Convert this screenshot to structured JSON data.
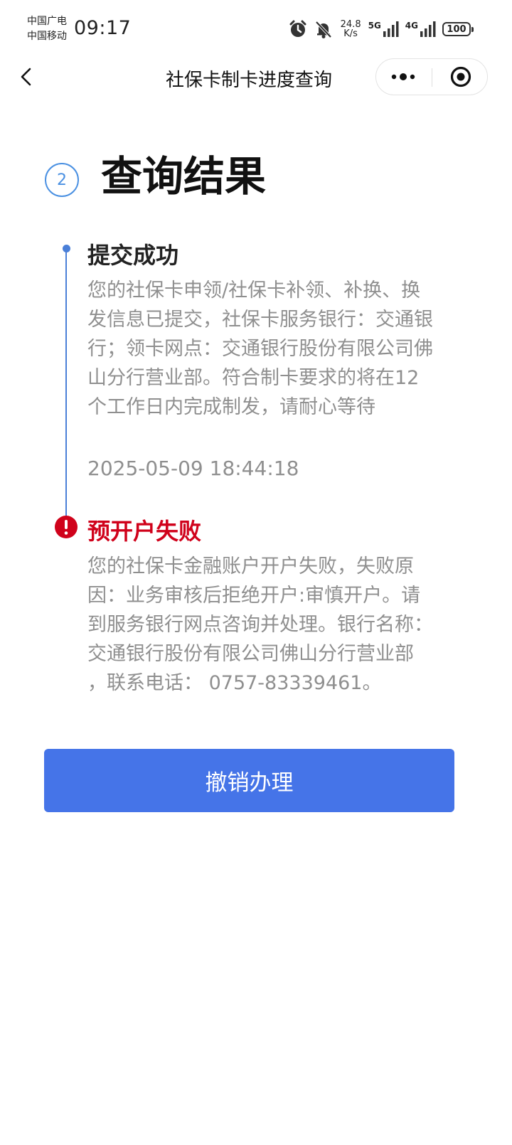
{
  "status_bar": {
    "carrier_1": "中国广电",
    "carrier_2": "中国移动",
    "time": "09:17",
    "net_speed_value": "24.8",
    "net_speed_unit": "K/s",
    "sig_5g": "5G",
    "sig_4g": "4G",
    "battery": "100"
  },
  "nav": {
    "title": "社保卡制卡进度查询"
  },
  "step": {
    "number": "2",
    "title": "查询结果"
  },
  "timeline": [
    {
      "status": "success",
      "title": "提交成功",
      "body": "您的社保卡申领/社保卡补领、补换、换发信息已提交，社保卡服务银行：交通银行；领卡网点：交通银行股份有限公司佛山分行营业部。符合制卡要求的将在12个工作日内完成制发，请耐心等待",
      "time": "2025-05-09 18:44:18"
    },
    {
      "status": "error",
      "title": "预开户失败",
      "body": "您的社保卡金融账户开户失败，失败原因：业务审核后拒绝开户:审慎开户。请到服务银行网点咨询并处理。银行名称：交通银行股份有限公司佛山分行营业部 ，联系电话： 0757-83339461。"
    }
  ],
  "action": {
    "cancel_label": "撤销办理"
  },
  "colors": {
    "accent_blue": "#4574e8",
    "timeline_blue": "#4a7fd8",
    "error_red": "#d0021b",
    "body_grey": "#8f8f8f"
  }
}
